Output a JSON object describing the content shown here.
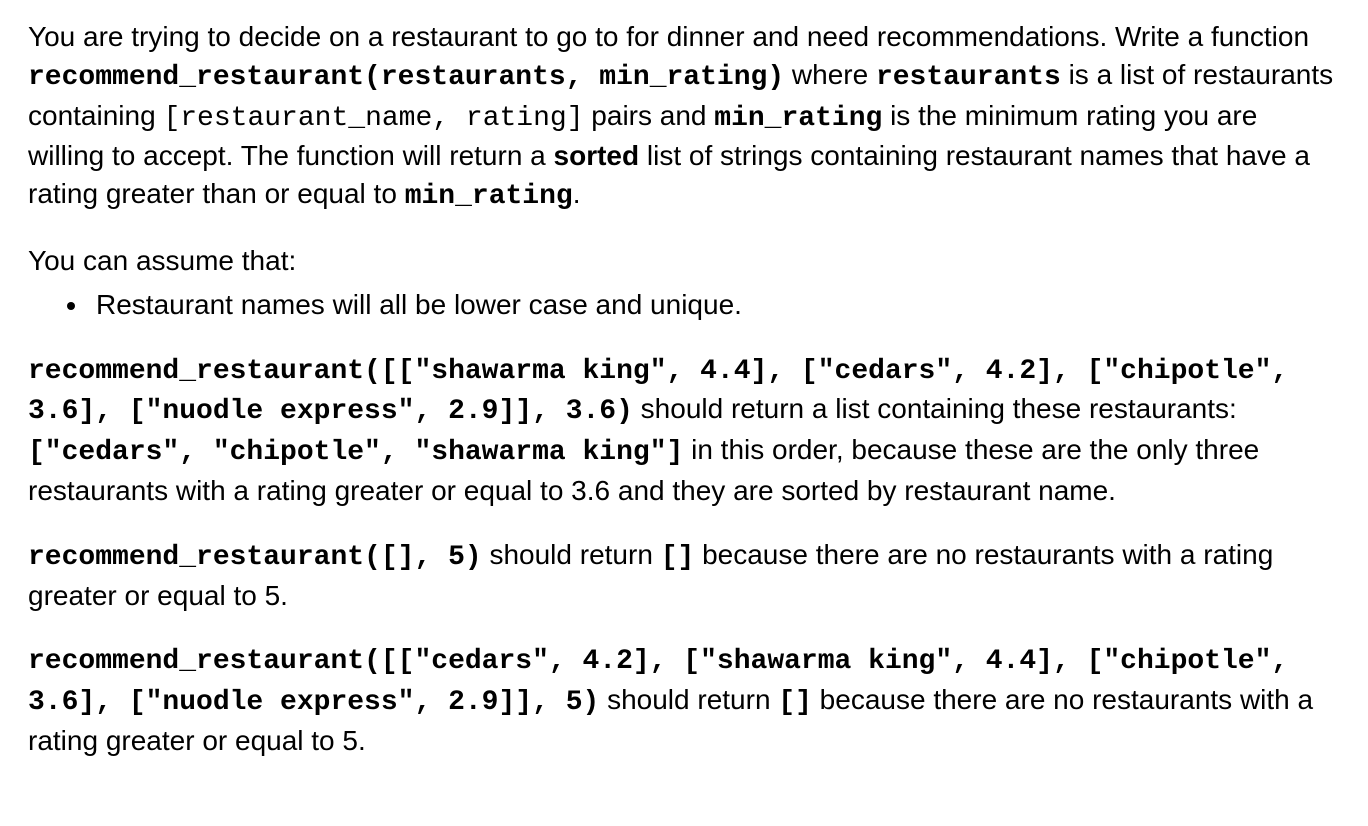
{
  "p1": {
    "t1": "You are trying to decide on a restaurant to go to for dinner and need recommendations. Write a function ",
    "c1": "recommend_restaurant(restaurants, min_rating)",
    "t2": " where ",
    "c2": "restaurants",
    "t3": " is a list of restaurants containing ",
    "c3": "[restaurant_name, rating]",
    "t4": " pairs and ",
    "c4": "min_rating",
    "t5": " is the minimum rating you are willing to accept. The function will return a ",
    "b1": "sorted",
    "t6": " list of strings containing restaurant names that have a rating greater than or equal to ",
    "c5": "min_rating",
    "t7": "."
  },
  "assume_head": "You can assume that:",
  "assume_item": "Restaurant names will all be lower case and unique.",
  "ex1": {
    "c1": "recommend_restaurant([[\"shawarma king\", 4.4], [\"cedars\", 4.2], [\"chipotle\", 3.6], [\"nuodle express\", 2.9]], 3.6)",
    "t1": " should return a list containing these restaurants: ",
    "c2": "[\"cedars\", \"chipotle\", \"shawarma king\"]",
    "t2": " in this order, because these are the only three restaurants with a rating greater or equal to 3.6 and they are sorted by restaurant name."
  },
  "ex2": {
    "c1": "recommend_restaurant([], 5)",
    "t1": " should return ",
    "c2": "[]",
    "t2": " because there are no restaurants with a rating greater or equal to 5."
  },
  "ex3": {
    "c1": "recommend_restaurant([[\"cedars\", 4.2], [\"shawarma king\", 4.4], [\"chipotle\", 3.6], [\"nuodle express\", 2.9]], 5)",
    "t1": " should return ",
    "c2": "[]",
    "t2": " because there are no restaurants with a rating greater or equal to 5."
  }
}
